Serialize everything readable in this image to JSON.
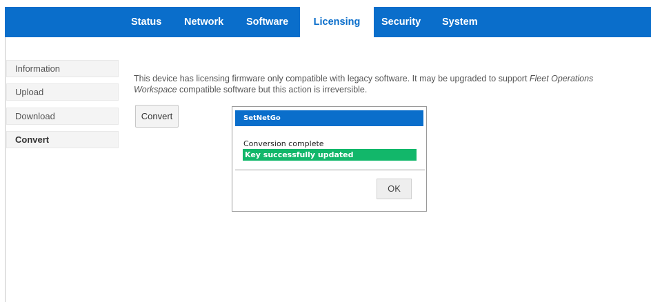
{
  "nav": {
    "tabs": [
      {
        "label": "Status"
      },
      {
        "label": "Network"
      },
      {
        "label": "Software"
      },
      {
        "label": "Licensing",
        "active": true
      },
      {
        "label": "Security"
      },
      {
        "label": "System"
      }
    ]
  },
  "sidebar": {
    "items": [
      {
        "label": "Information"
      },
      {
        "label": "Upload"
      },
      {
        "label": "Download"
      },
      {
        "label": "Convert",
        "active": true
      }
    ]
  },
  "content": {
    "description_part1": "This device has licensing firmware only compatible with legacy software. It may be upgraded to support ",
    "description_emphasis": "Fleet Operations Workspace",
    "description_part2": " compatible software but this action is irreversible.",
    "convert_button": "Convert"
  },
  "dialog": {
    "title": "SetNetGo",
    "message": "Conversion complete",
    "status": "Key successfully updated",
    "ok_button": "OK"
  },
  "colors": {
    "brand_blue": "#0a6ecb",
    "success_green": "#12b76a"
  }
}
